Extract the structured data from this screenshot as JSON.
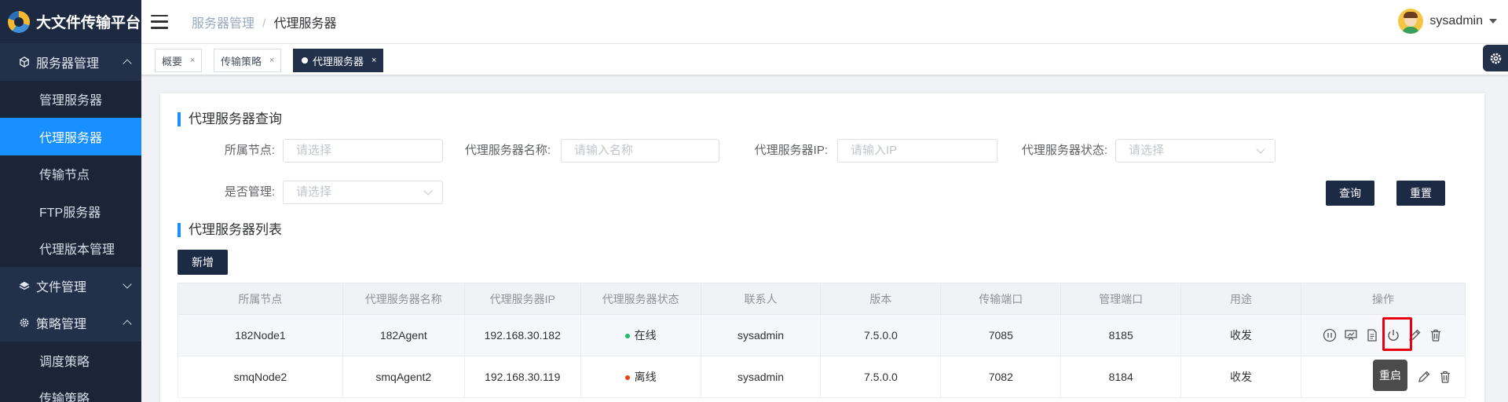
{
  "app": {
    "title": "大文件传输平台"
  },
  "sidebar": {
    "items": [
      {
        "label": "服务器管理",
        "type": "group",
        "icon": "cube-icon",
        "expanded": true
      },
      {
        "label": "管理服务器",
        "type": "sub"
      },
      {
        "label": "代理服务器",
        "type": "sub",
        "active": true
      },
      {
        "label": "传输节点",
        "type": "sub"
      },
      {
        "label": "FTP服务器",
        "type": "sub"
      },
      {
        "label": "代理版本管理",
        "type": "sub"
      },
      {
        "label": "文件管理",
        "type": "group",
        "icon": "layers-icon",
        "expanded": false
      },
      {
        "label": "策略管理",
        "type": "group",
        "icon": "gear-icon",
        "expanded": true
      },
      {
        "label": "调度策略",
        "type": "sub"
      },
      {
        "label": "传输策略",
        "type": "sub"
      }
    ]
  },
  "header": {
    "breadcrumb": [
      "服务器管理",
      "代理服务器"
    ],
    "user": "sysadmin"
  },
  "tabs": [
    {
      "label": "概要",
      "active": false
    },
    {
      "label": "传输策略",
      "active": false
    },
    {
      "label": "代理服务器",
      "active": true
    }
  ],
  "query": {
    "title": "代理服务器查询",
    "fields": [
      {
        "label": "所属节点:",
        "placeholder": "请选择"
      },
      {
        "label": "代理服务器名称:",
        "placeholder": "请输入名称"
      },
      {
        "label": "代理服务器IP:",
        "placeholder": "请输入IP"
      },
      {
        "label": "代理服务器状态:",
        "placeholder": "请选择"
      },
      {
        "label": "是否管理:",
        "placeholder": "请选择"
      }
    ],
    "search_label": "查询",
    "reset_label": "重置"
  },
  "list": {
    "title": "代理服务器列表",
    "add_label": "新增",
    "columns": [
      "所属节点",
      "代理服务器名称",
      "代理服务器IP",
      "代理服务器状态",
      "联系人",
      "版本",
      "传输端口",
      "管理端口",
      "用途",
      "操作"
    ],
    "rows": [
      {
        "node": "182Node1",
        "name": "182Agent",
        "ip": "192.168.30.182",
        "status": "在线",
        "status_color": "#19be6b",
        "contact": "sysadmin",
        "version": "7.5.0.0",
        "transfer_port": "7085",
        "manage_port": "8185",
        "usage": "收发"
      },
      {
        "node": "smqNode2",
        "name": "smqAgent2",
        "ip": "192.168.30.119",
        "status": "离线",
        "status_color": "#ed4014",
        "contact": "sysadmin",
        "version": "7.5.0.0",
        "transfer_port": "7082",
        "manage_port": "8184",
        "usage": "收发"
      }
    ]
  },
  "tooltip": {
    "text": "重启"
  },
  "colors": {
    "sidebar": "#22304a",
    "accent": "#1890ff",
    "button": "#1d2a44",
    "highlight": "#e60012"
  }
}
